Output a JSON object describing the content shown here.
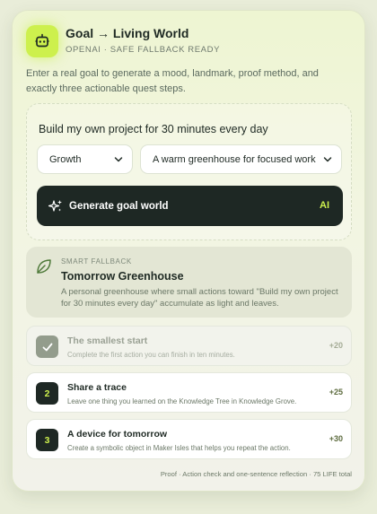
{
  "header": {
    "title": "Goal → Living World",
    "subtitle": "OPENAI · SAFE FALLBACK READY",
    "icon": "robot-icon",
    "accent_color": "#cdf04d"
  },
  "description": "Enter a real goal to generate a mood, landmark, proof method, and exactly three actionable quest steps.",
  "form": {
    "goal_text": "Build my own project for 30 minutes every day",
    "category_value": "Growth",
    "world_value": "A warm greenhouse for focused work",
    "generate_label": "Generate goal world",
    "ai_badge": "AI"
  },
  "world": {
    "kicker": "SMART FALLBACK",
    "title": "Tomorrow Greenhouse",
    "description": "A personal greenhouse where small actions toward \"Build my own project for 30 minutes every day\" accumulate as light and leaves."
  },
  "quests": [
    {
      "marker": "✓",
      "title": "The smallest start",
      "description": "Complete the first action you can finish in ten minutes.",
      "points": "+20",
      "completed": true
    },
    {
      "marker": "2",
      "title": "Share a trace",
      "description": "Leave one thing you learned on the Knowledge Tree in Knowledge Grove.",
      "points": "+25",
      "completed": false
    },
    {
      "marker": "3",
      "title": "A device for tomorrow",
      "description": "Create a symbolic object in Maker Isles that helps you repeat the action.",
      "points": "+30",
      "completed": false
    }
  ],
  "footer": "Proof · Action check and one-sentence reflection · 75 LIFE total"
}
